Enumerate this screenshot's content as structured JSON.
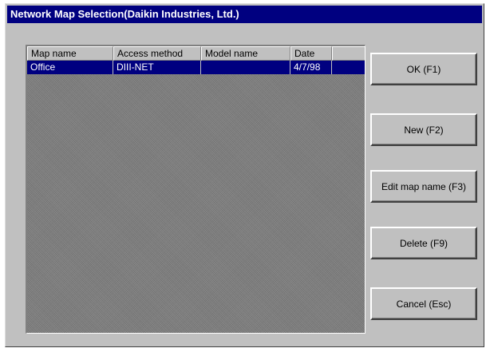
{
  "window": {
    "title": "Network Map Selection(Daikin Industries, Ltd.)"
  },
  "list": {
    "columns": [
      "Map name",
      "Access method",
      "Model name",
      "Date"
    ],
    "rows": [
      {
        "map_name": "Office",
        "access_method": "DIII-NET",
        "model_name": "",
        "date": "4/7/98"
      }
    ]
  },
  "buttons": {
    "ok": "OK (F1)",
    "new": "New (F2)",
    "edit": "Edit map name (F3)",
    "delete": "Delete (F9)",
    "cancel": "Cancel (Esc)"
  },
  "colors": {
    "titlebar": "#000080",
    "selection": "#000080",
    "face": "#c0c0c0"
  }
}
